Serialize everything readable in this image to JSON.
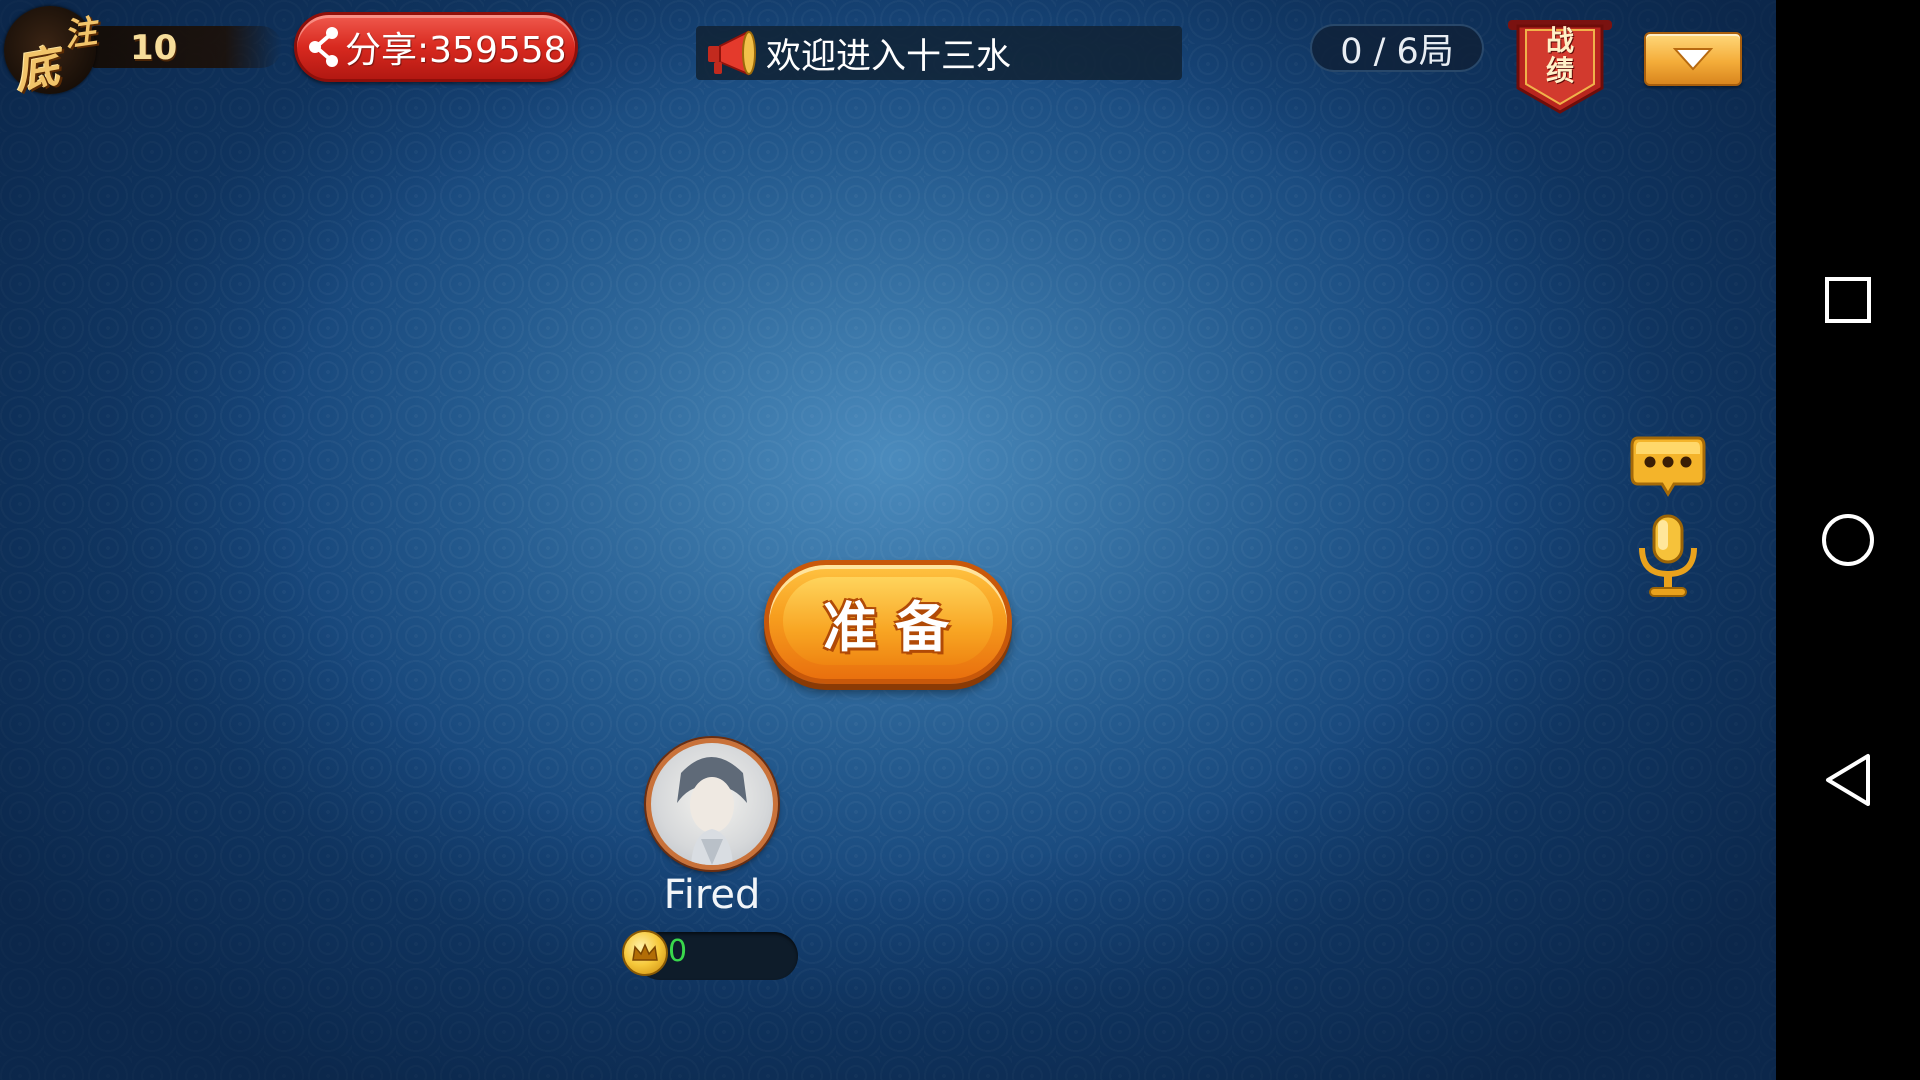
{
  "bet": {
    "label_char_1": "底",
    "label_char_2": "注",
    "value": "10"
  },
  "share": {
    "label": "分享:359558"
  },
  "notice": {
    "text": "欢迎进入十三水"
  },
  "rounds": {
    "label": "0 / 6局"
  },
  "record": {
    "label_line1": "战",
    "label_line2": "绩"
  },
  "ready": {
    "label": "准备"
  },
  "player": {
    "name": "Fired",
    "coins": "0"
  },
  "icons": {
    "share": "share-icon",
    "notice": "megaphone-icon",
    "menu": "chevron-down-icon",
    "chat": "chat-bubble-icon",
    "voice": "microphone-icon",
    "coin": "crown-coin-icon",
    "nav_recents": "square-icon",
    "nav_home": "circle-icon",
    "nav_back": "triangle-back-icon"
  },
  "colors": {
    "table_blue": "#3a76a8",
    "share_red": "#d8291f",
    "ready_orange": "#f79e1e",
    "coin_text_green": "#39d84c"
  }
}
